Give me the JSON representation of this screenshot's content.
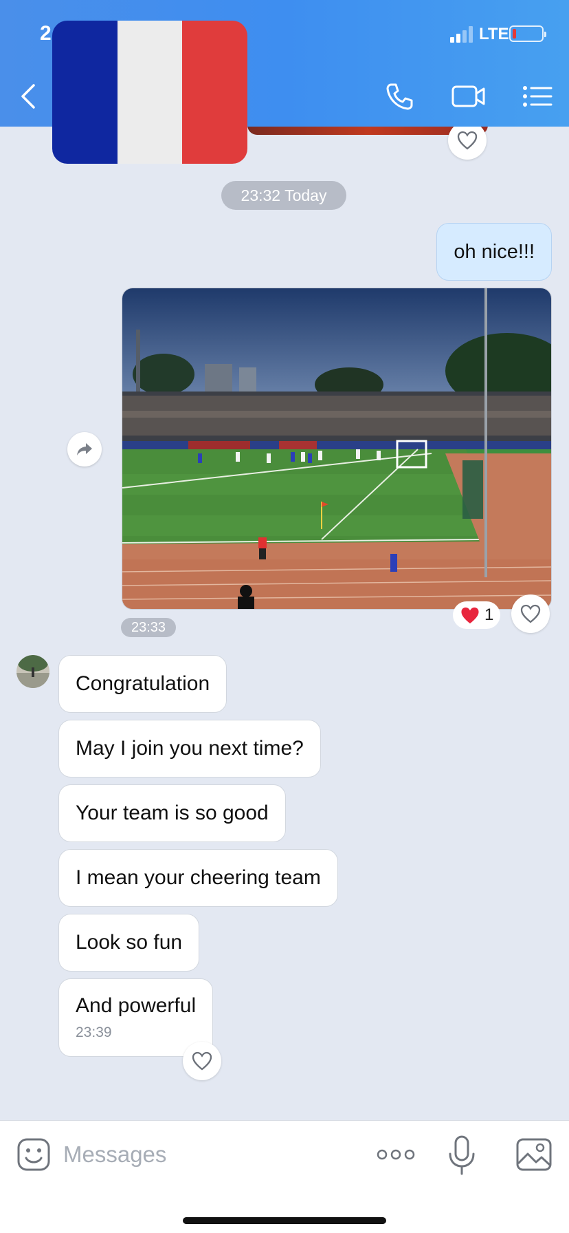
{
  "status_bar": {
    "time": "2",
    "network": "LTE"
  },
  "header": {
    "flag_colors": [
      "#0f27a0",
      "#ececec",
      "#e03c3c"
    ],
    "icons": [
      "back-arrow-icon",
      "phone-icon",
      "video-camera-icon",
      "list-menu-icon"
    ]
  },
  "chat": {
    "date_divider": "23:32 Today",
    "outgoing_text": "oh nice!!!",
    "photo_reaction": {
      "emoji": "❤️",
      "count": "1"
    },
    "photo_time": "23:33",
    "incoming": [
      {
        "text": "Congratulation"
      },
      {
        "text": "May I join you next time?"
      },
      {
        "text": "Your team is so good"
      },
      {
        "text": "I mean your cheering team"
      },
      {
        "text": "Look so fun"
      },
      {
        "text": "And powerful",
        "time": "23:39"
      }
    ]
  },
  "input_bar": {
    "placeholder": "Messages"
  },
  "colors": {
    "accent": "#3e8ef0",
    "outgoing_bubble": "#d6ebff",
    "background": "#e3e8f2"
  }
}
